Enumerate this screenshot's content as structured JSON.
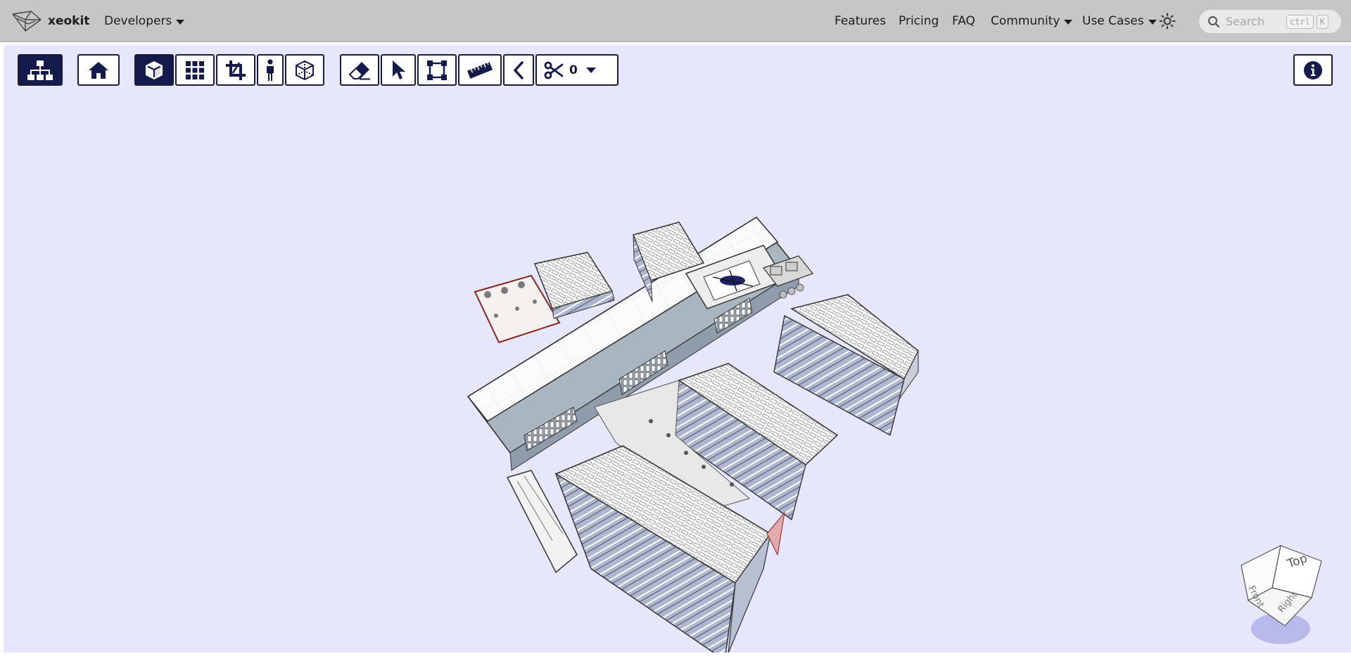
{
  "navbar": {
    "brand": "xeokit",
    "developers": "Developers",
    "features": "Features",
    "pricing": "Pricing",
    "faq": "FAQ",
    "community": "Community",
    "use_cases": "Use Cases",
    "search_placeholder": "Search",
    "search_key_1": "ctrl",
    "search_key_2": "K"
  },
  "toolbar": {
    "buttons": [
      {
        "icon": "sitemap-icon",
        "active": true
      },
      {
        "icon": "home-icon",
        "active": false
      },
      {
        "icon": "3d-cube-icon",
        "active": true
      },
      {
        "icon": "grid-icon",
        "active": false
      },
      {
        "icon": "crop-icon",
        "active": false
      },
      {
        "icon": "person-icon",
        "active": false
      },
      {
        "icon": "xray-cube-icon",
        "active": false
      },
      {
        "icon": "eraser-icon",
        "active": false
      },
      {
        "icon": "pointer-icon",
        "active": false
      },
      {
        "icon": "marquee-select-icon",
        "active": false
      },
      {
        "icon": "ruler-icon",
        "active": false
      },
      {
        "icon": "chevron-left-icon",
        "active": false
      },
      {
        "icon": "scissors-icon",
        "active": false
      },
      {
        "icon": "info-icon",
        "active": false
      }
    ],
    "section_plane_count": "0"
  },
  "navcube": {
    "top": "Top",
    "front": "Front",
    "right": "Right"
  },
  "colors": {
    "navbar_bg": "#c6c6c6",
    "viewer_bg": "#e6e7fc",
    "button_active": "#151a4d",
    "button_border": "#1b1b3f"
  }
}
